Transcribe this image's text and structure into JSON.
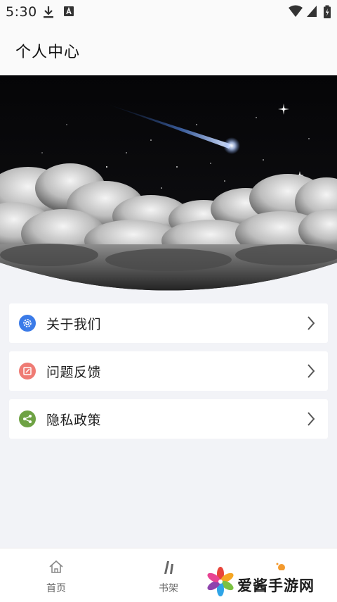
{
  "status_bar": {
    "time": "5:30"
  },
  "header": {
    "title": "个人中心"
  },
  "menu": {
    "items": [
      {
        "label": "关于我们",
        "icon": "settings-icon",
        "color": "#3b7be8"
      },
      {
        "label": "问题反馈",
        "icon": "feedback-icon",
        "color": "#ef7b74"
      },
      {
        "label": "隐私政策",
        "icon": "share-icon",
        "color": "#6ea244"
      }
    ]
  },
  "bottom_nav": {
    "items": [
      {
        "label": "首页",
        "icon": "home-icon"
      },
      {
        "label": "书架",
        "icon": "bookshelf-icon"
      },
      {
        "label": "",
        "icon": "profile-icon"
      }
    ]
  },
  "watermark": {
    "text": "爱酱手游网"
  },
  "colors": {
    "background": "#f2f3f7",
    "card": "#ffffff",
    "accent_orange": "#f39a2e"
  }
}
